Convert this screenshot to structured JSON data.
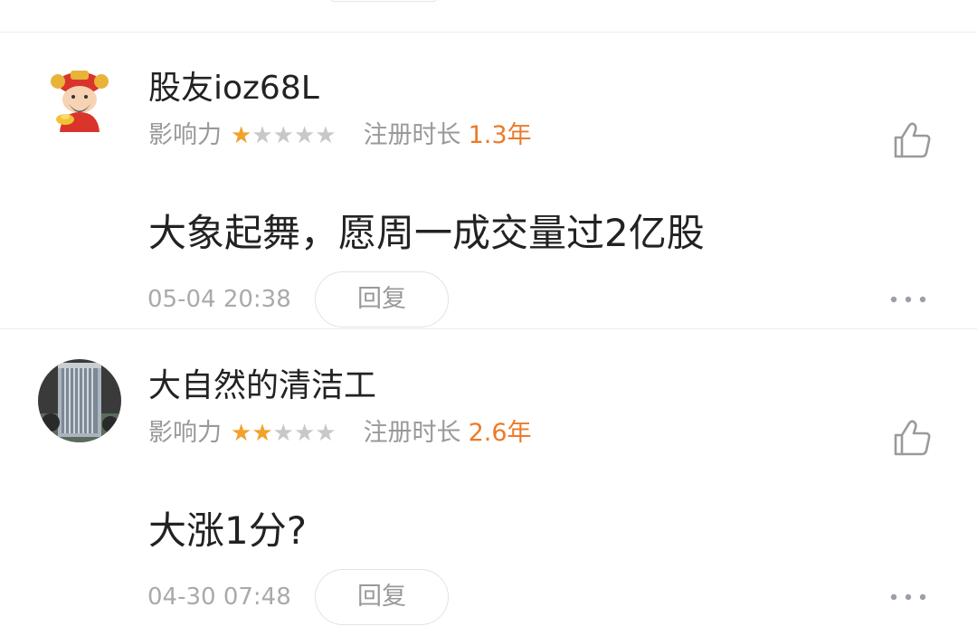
{
  "comments": [
    {
      "username": "股友ioz68L",
      "influence_label": "影响力",
      "influence_stars": 1,
      "influence_max": 5,
      "reg_label": "注册时长",
      "reg_value": "1.3年",
      "content": "大象起舞，愿周一成交量过2亿股",
      "time": "05-04 20:38",
      "reply_label": "回复",
      "avatar": "caishen-avatar"
    },
    {
      "username": "大自然的清洁工",
      "influence_label": "影响力",
      "influence_stars": 2,
      "influence_max": 5,
      "reg_label": "注册时长",
      "reg_value": "2.6年",
      "content": "大涨1分?",
      "time": "04-30 07:48",
      "reply_label": "回复",
      "avatar": "radiator-photo-avatar"
    }
  ],
  "colors": {
    "star_on": "#f0a22b",
    "star_off": "#c8c8c8",
    "reg_value": "#ec7a28",
    "muted": "#999999"
  }
}
